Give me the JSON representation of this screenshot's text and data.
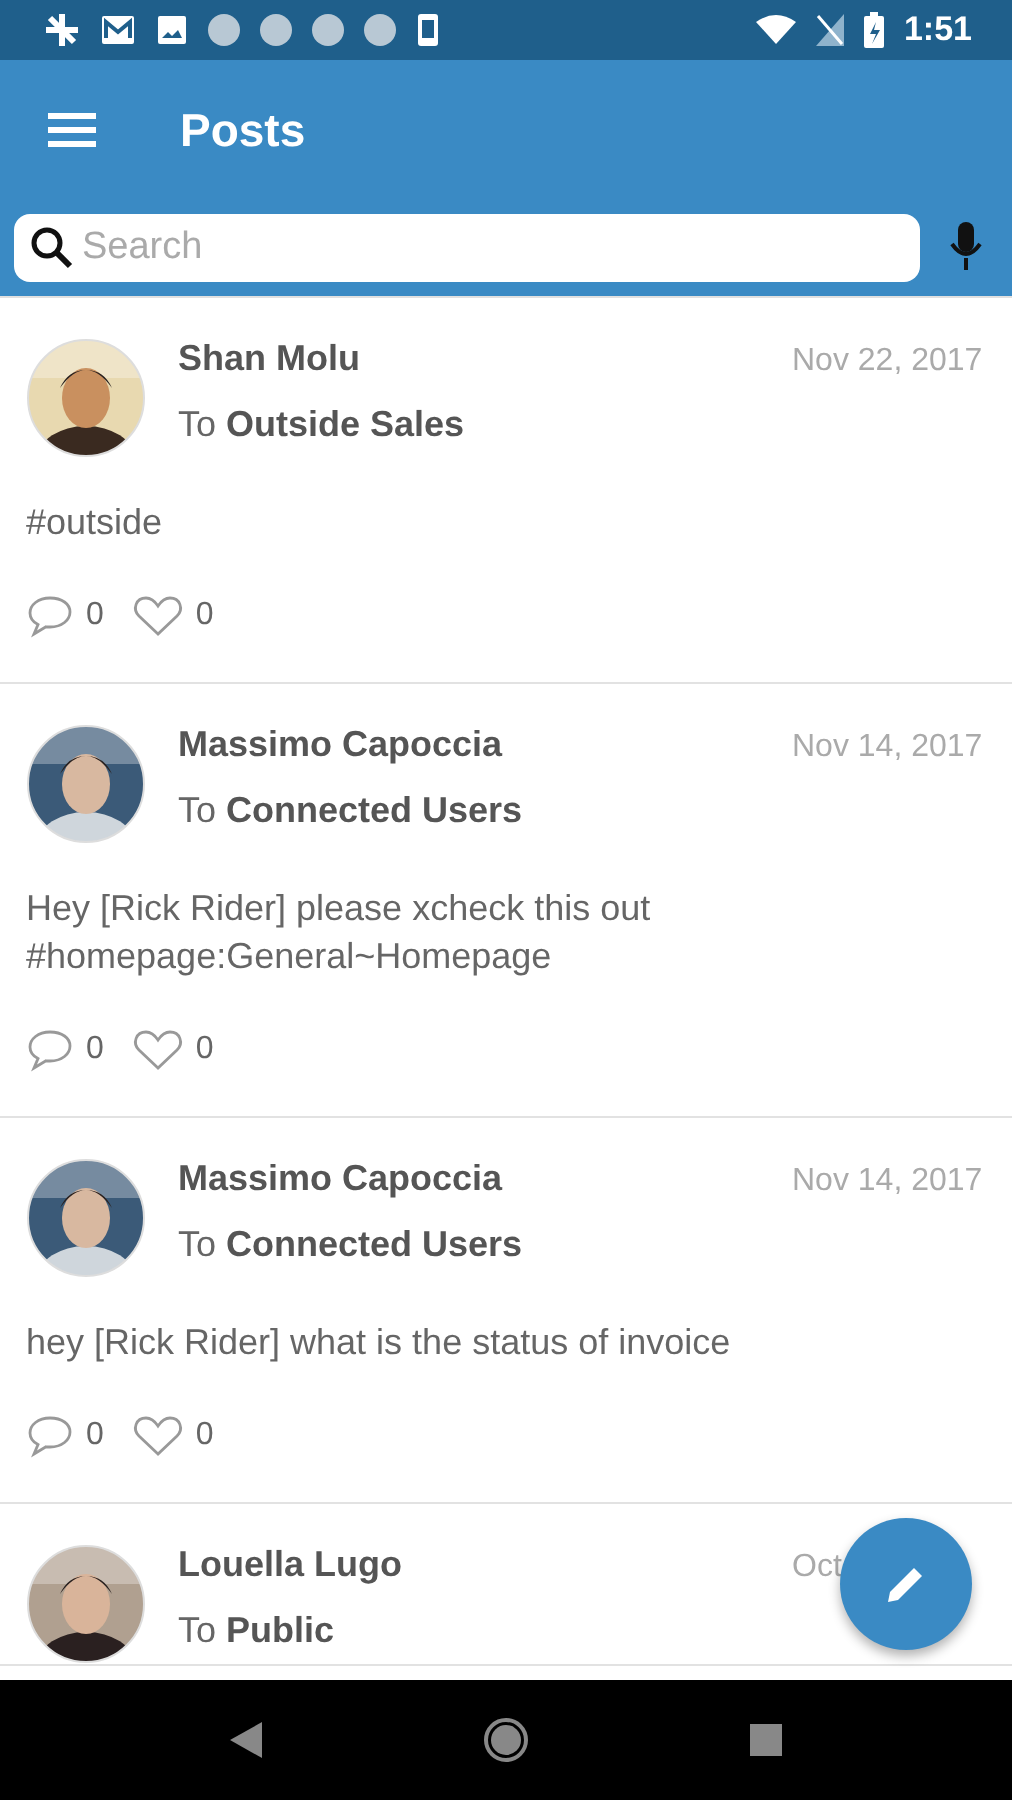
{
  "status_bar": {
    "time": "1:51"
  },
  "app_bar": {
    "title": "Posts"
  },
  "search": {
    "placeholder": "Search"
  },
  "posts": [
    {
      "author": "Shan Molu",
      "audience": "To **Outside Sales**",
      "date": "Nov 22, 2017",
      "body": "#outside",
      "comments": "0",
      "likes": "0"
    },
    {
      "author": "Massimo Capoccia",
      "audience": "To **Connected Users**",
      "date": "Nov 14, 2017",
      "body": "Hey [Rick Rider] please xcheck this out #homepage:General~Homepage",
      "comments": "0",
      "likes": "0"
    },
    {
      "author": "Massimo Capoccia",
      "audience": "To **Connected Users**",
      "date": "Nov 14, 2017",
      "body": "hey [Rick Rider] what is the status of invoice",
      "comments": "0",
      "likes": "0"
    },
    {
      "author": "Louella Lugo",
      "audience": "To **Public**",
      "date": "Oct"
    }
  ]
}
